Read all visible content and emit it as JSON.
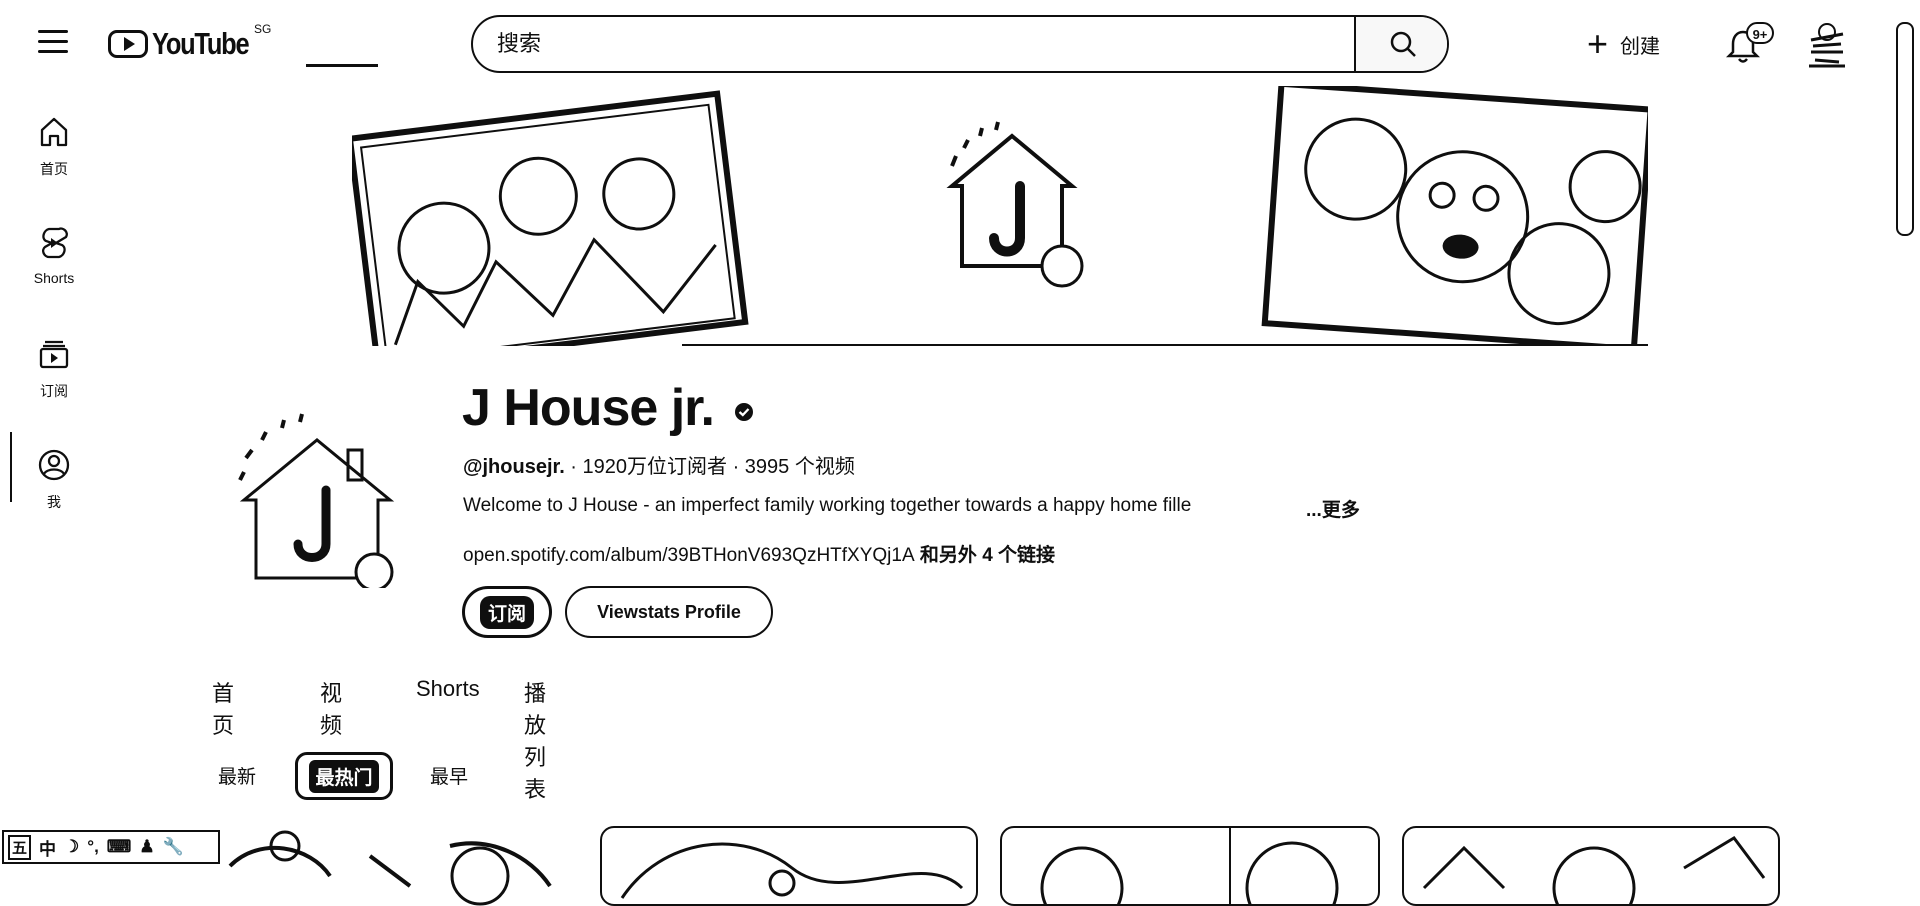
{
  "header": {
    "logo_text": "YouTube",
    "region": "SG",
    "search_placeholder": "搜索",
    "create_label": "创建",
    "notification_count": "9+"
  },
  "sidebar": {
    "items": [
      {
        "label": "首页",
        "icon": "home-icon"
      },
      {
        "label": "Shorts",
        "icon": "shorts-icon"
      },
      {
        "label": "订阅",
        "icon": "subscriptions-icon"
      },
      {
        "label": "我",
        "icon": "you-icon"
      }
    ]
  },
  "channel": {
    "name": "J House jr.",
    "handle": "@jhousejr.",
    "stats": " · 1920万位订阅者 · 3995 个视频",
    "description": "Welcome to J House - an imperfect family working together towards a  happy home fille",
    "more": "...更多",
    "link": "open.spotify.com/album/39BTHonV693QzHTfXYQj1A",
    "link_extra": " 和另外 4 个链接",
    "subscribe_label": "订阅",
    "profile_button": "Viewstats Profile"
  },
  "tabs": [
    {
      "label": "首页",
      "active": false
    },
    {
      "label": "视频",
      "active": true
    },
    {
      "label": "Shorts",
      "active": false
    },
    {
      "label": "播放列表",
      "active": false
    }
  ],
  "chips": [
    {
      "label": "最新",
      "active": false
    },
    {
      "label": "最热门",
      "active": true
    },
    {
      "label": "最早",
      "active": false
    }
  ],
  "ime_toolbar": [
    "五",
    "中",
    "☽",
    "°,",
    "⌨",
    "♟",
    "🔧"
  ],
  "colors": {
    "ink": "#0f0f0f",
    "background": "#ffffff"
  }
}
